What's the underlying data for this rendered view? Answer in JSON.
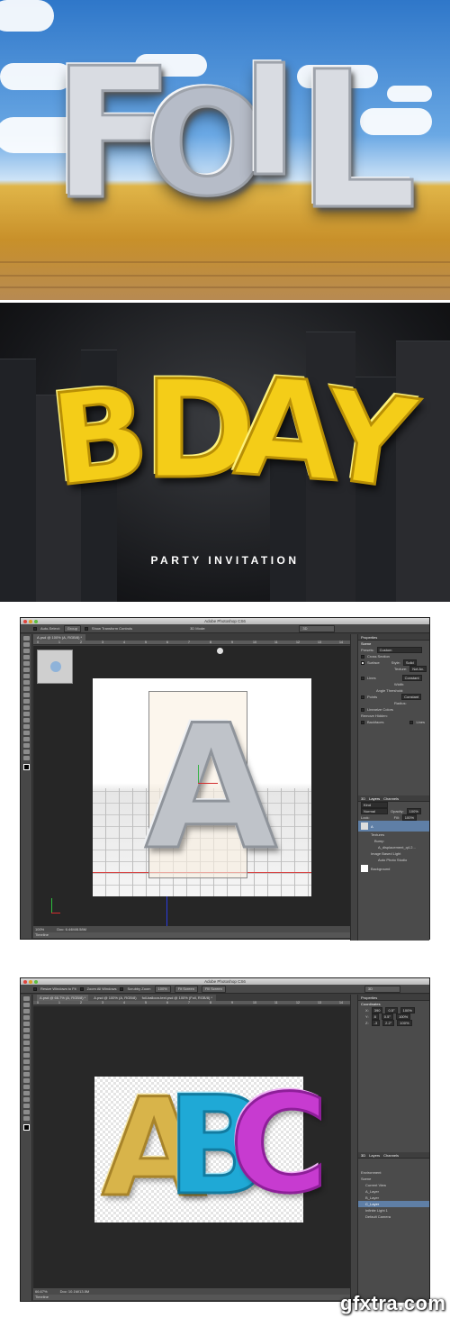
{
  "panel1": {
    "word": [
      "F",
      "O",
      "I",
      "L"
    ]
  },
  "panel2": {
    "word": [
      "B",
      "D",
      "A",
      "Y"
    ],
    "subtitle": "PARTY INVITATION"
  },
  "ps1": {
    "window_title": "Adobe Photoshop CS6",
    "options": {
      "auto_select": "Auto-Select:",
      "group": "Group",
      "show_transform": "Show Transform Controls",
      "mode_3d": "3D Mode:",
      "workspace": "3D"
    },
    "doc_tab": "A.psd @ 100% (A, RGB/8) *",
    "ruler_ticks": [
      "0",
      "1",
      "2",
      "3",
      "4",
      "5",
      "6",
      "7",
      "8",
      "9",
      "10",
      "11",
      "12",
      "13",
      "14"
    ],
    "status": {
      "zoom": "100%",
      "doc": "Doc: 6.44M/8.58M"
    },
    "timeline": "Timeline",
    "properties": {
      "tab": "Properties",
      "scene": "Scene",
      "presets_label": "Presets:",
      "presets_value": "Custom",
      "cross_section": "Cross Section",
      "surface": "Surface",
      "style_label": "Style:",
      "style_value": "Solid",
      "texture_label": "Texture:",
      "texture_value": "Not Av.",
      "lines": "Lines",
      "lines_style": "Constant",
      "width_label": "Width:",
      "angle_label": "Angle Threshold:",
      "points": "Points",
      "points_style": "Constant",
      "radius_label": "Radius:",
      "linearize": "Linearize Colors",
      "remove_hidden": "Remove Hidden:",
      "backfaces": "Backfaces",
      "lines_chk": "Lines"
    },
    "layers": {
      "tabs": [
        "3D",
        "Layers",
        "Channels"
      ],
      "kind": "Kind",
      "blend": "Normal",
      "opacity_label": "Opacity:",
      "opacity_value": "100%",
      "lock_label": "Lock:",
      "fill_label": "Fill:",
      "fill_value": "100%",
      "items": [
        "A",
        "Textures",
        "Bump",
        "A_displacement_q4.2...",
        "Image Based Light",
        "Auto Photo Studio",
        "Background"
      ]
    }
  },
  "ps2": {
    "window_title": "Adobe Photoshop CS6",
    "options": {
      "resize": "Resize Windows to Fit",
      "zoom_all": "Zoom All Windows",
      "scrubby": "Scrubby Zoom",
      "pct": "100%",
      "fit": "Fit Screen",
      "fill": "Fill Screen",
      "workspace": "3D"
    },
    "doc_tabs": [
      "A.psd @ 66.7% (A, RGB/8) *",
      "A.psd @ 100% (A, RGB/8)",
      "foil-balloon-text.psd @ 100% (Foil, RGB/8) *"
    ],
    "ruler_ticks": [
      "0",
      "1",
      "2",
      "3",
      "4",
      "5",
      "6",
      "7",
      "8",
      "9",
      "10",
      "11",
      "12",
      "13",
      "14"
    ],
    "letters": [
      "A",
      "B",
      "C"
    ],
    "letter_colors": [
      "#d8b44a",
      "#1fa9d6",
      "#c73bd0"
    ],
    "status": {
      "zoom": "66.67%",
      "doc": "Doc: 10.1M/13.5M"
    },
    "timeline": "Timeline",
    "properties": {
      "tab": "Properties",
      "coordinates": "Coordinates",
      "x": "X:",
      "x_val": "390",
      "x_rot": "0.5°",
      "x_scale": "100%",
      "y": "Y:",
      "y_val": "8",
      "y_rot": "0.5°",
      "y_scale": "100%",
      "z": "Z:",
      "z_val": "-3",
      "z_rot": "2.2°",
      "z_scale": "100%"
    },
    "layers": {
      "tabs": [
        "3D",
        "Layers",
        "Channels"
      ],
      "items": [
        "Environment",
        "Scene",
        "Current View",
        "A_Layer",
        "B_Layer",
        "C_Layer",
        "Infinite Light 1",
        "Default Camera"
      ]
    }
  },
  "watermark": "gfxtra.com",
  "colors": {
    "foil": "#d9dce2",
    "gold": "#f4cd18",
    "ps_bg": "#3b3b3b"
  }
}
